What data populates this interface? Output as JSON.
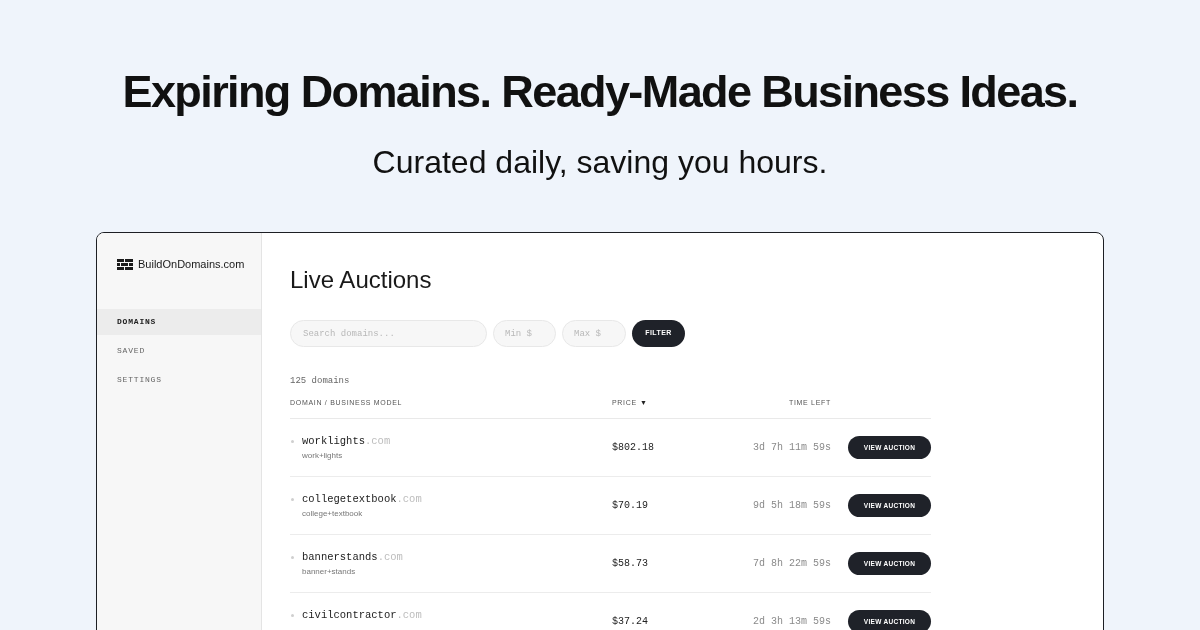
{
  "hero": {
    "title": "Expiring Domains. Ready-Made Business Ideas.",
    "subtitle": "Curated daily, saving you hours."
  },
  "app": {
    "sidebar": {
      "logo": "BuildOnDomains.com",
      "items": [
        {
          "label": "DOMAINS",
          "selected": true
        },
        {
          "label": "SAVED",
          "selected": false
        },
        {
          "label": "SETTINGS",
          "selected": false
        }
      ]
    },
    "main": {
      "title": "Live Auctions",
      "filters": {
        "search": {
          "placeholder": "Search domains..."
        },
        "min": {
          "placeholder": "Min $"
        },
        "max": {
          "placeholder": "Max $"
        },
        "button": "FILTER"
      },
      "count": "125 domains",
      "table": {
        "columns": [
          {
            "label": "DOMAIN / BUSINESS MODEL"
          },
          {
            "label": "PRICE",
            "sort_mark": "▼"
          },
          {
            "label": "TIME LEFT"
          }
        ],
        "rows": [
          {
            "name": "worklights",
            "tld": ".com",
            "model": "work+lights",
            "price": "$802.18",
            "time_left": "3d 7h 11m 59s",
            "action": "VIEW AUCTION"
          },
          {
            "name": "collegetextbook",
            "tld": ".com",
            "model": "college+textbook",
            "price": "$70.19",
            "time_left": "9d 5h 18m 59s",
            "action": "VIEW AUCTION"
          },
          {
            "name": "bannerstands",
            "tld": ".com",
            "model": "banner+stands",
            "price": "$58.73",
            "time_left": "7d 8h 22m 59s",
            "action": "VIEW AUCTION"
          },
          {
            "name": "civilcontractor",
            "tld": ".com",
            "price": "$37.24",
            "time_left": "2d 3h 13m 59s",
            "action": "VIEW AUCTION"
          }
        ]
      }
    }
  }
}
